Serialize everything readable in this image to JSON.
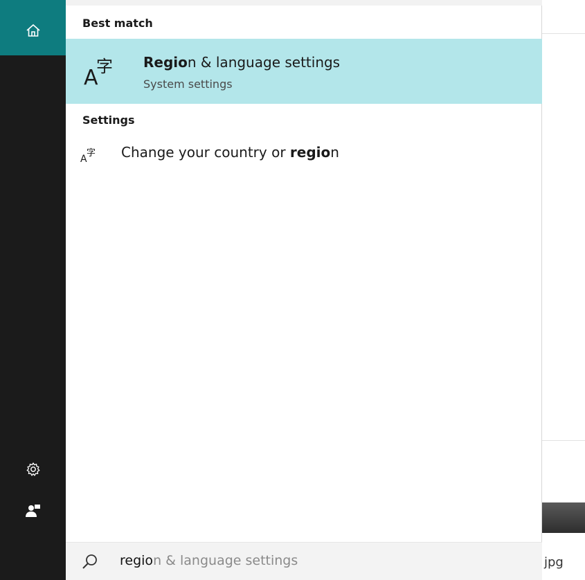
{
  "rail": {
    "home_icon": "home-icon",
    "settings_icon": "gear-icon",
    "account_icon": "user-icon"
  },
  "results": {
    "best_match_heading": "Best match",
    "best_match": {
      "title_bold": "Regio",
      "title_rest": "n & language settings",
      "subtitle": "System settings",
      "icon": "language-icon"
    },
    "settings_heading": "Settings",
    "settings_items": [
      {
        "prefix": "Change your country or ",
        "bold": "regio",
        "suffix": "n",
        "icon": "language-icon"
      }
    ]
  },
  "search": {
    "typed": "regio",
    "suggestion": "n & language settings",
    "icon": "search-icon"
  },
  "background": {
    "file_label": "jpg"
  },
  "colors": {
    "accent": "#0e7c7f",
    "highlight": "#b3e6ea",
    "rail": "#1b1b1b"
  }
}
